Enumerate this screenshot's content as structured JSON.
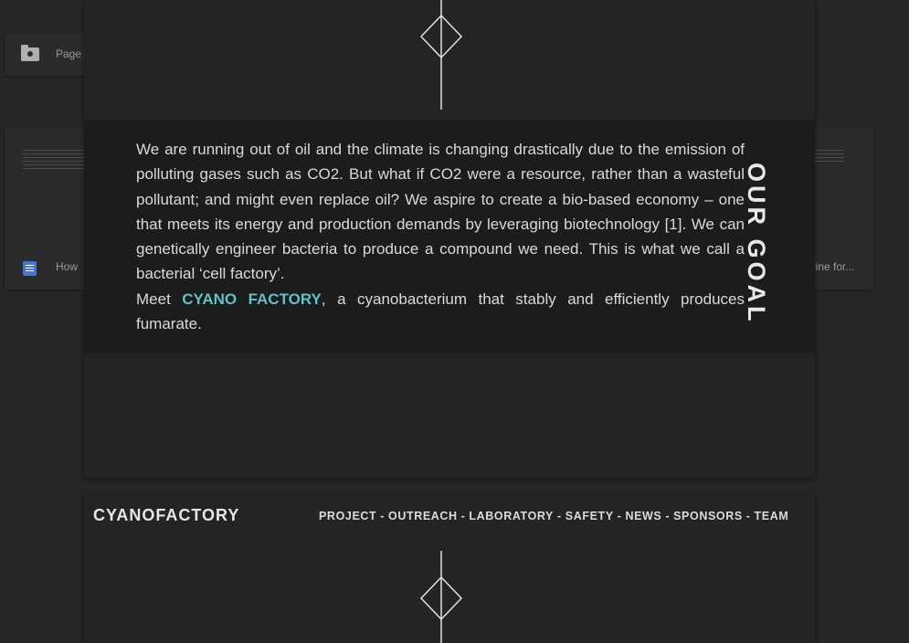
{
  "background": {
    "folder_label": "Page",
    "doc_left_label": "How",
    "doc_right_label": "line for..."
  },
  "goal": {
    "heading": "OUR GOAL",
    "paragraph1": "We are running out of oil and the climate is changing drastically due to the emission of polluting gases such as CO2. But what if CO2 were a resource, rather than a wasteful pollutant; and might even replace oil? We aspire to create a bio-based economy – one that meets its energy and production demands by leveraging biotechnology [1]. We can genetically engineer bacteria to produce a compound we need. This is what we call a bacterial ‘cell factory’.",
    "p2_prefix": "Meet ",
    "p2_highlight": "CYANO FACTORY",
    "p2_suffix": ", a cyanobacterium that stably and efficiently produces fumarate."
  },
  "header": {
    "brand": "CYANOFACTORY",
    "nav": {
      "project": "PROJECT",
      "outreach": "OUTREACH",
      "laboratory": "LABORATORY",
      "safety": "SAFETY",
      "news": "NEWS",
      "sponsors": "SPONSORS",
      "team": "TEAM",
      "sep": "-"
    }
  },
  "colors": {
    "accent": "#5fc2c6",
    "background": "#262626",
    "goal_box": "#1c1c1c"
  },
  "icons": {
    "divider": "diamond-divider-icon",
    "folder": "folder-icon",
    "doc": "doc-icon"
  }
}
